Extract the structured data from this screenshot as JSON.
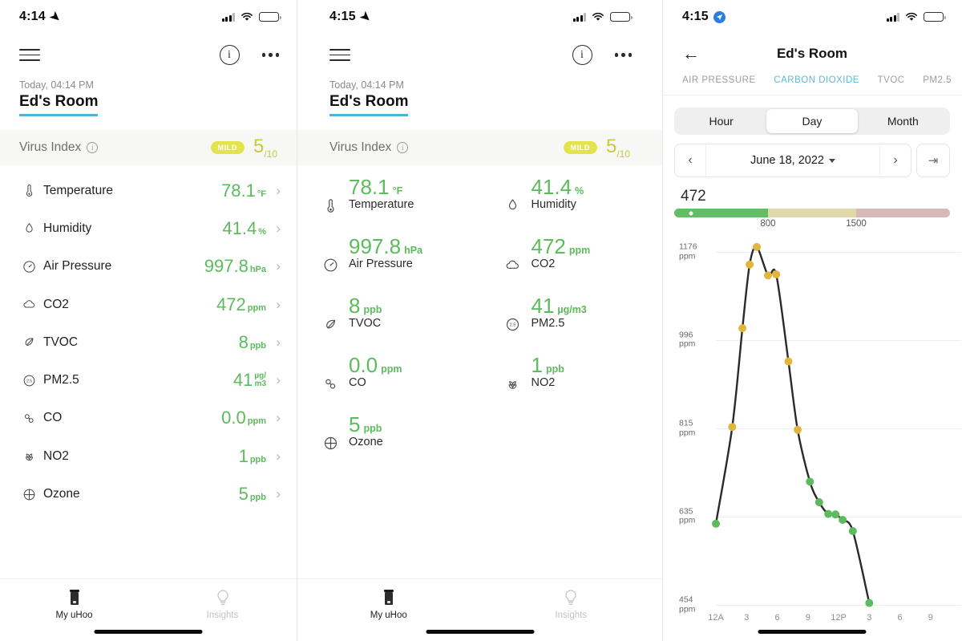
{
  "panel1": {
    "status": {
      "time": "4:14",
      "location_icon": "location-arrow-icon",
      "battery_level_pct": 42
    },
    "nav": {
      "menu_icon": "hamburger-menu-icon",
      "info_icon": "info-circle-icon",
      "more_icon": "more-options-icon"
    },
    "header": {
      "timestamp": "Today, 04:14 PM",
      "room": "Ed's Room"
    },
    "virus_index": {
      "label": "Virus Index",
      "info_icon": "info-icon",
      "badge": "MILD",
      "score": "5",
      "score_denom": "/10"
    },
    "metrics": [
      {
        "name": "Temperature",
        "icon": "thermometer-icon",
        "value": "78.1",
        "unit": "°F",
        "fill": 85
      },
      {
        "name": "Humidity",
        "icon": "droplet-icon",
        "value": "41.4",
        "unit": "%",
        "fill": 55
      },
      {
        "name": "Air Pressure",
        "icon": "gauge-icon",
        "value": "997.8",
        "unit": "hPa",
        "fill": 47
      },
      {
        "name": "CO2",
        "icon": "cloud-icon",
        "value": "472",
        "unit": "ppm",
        "fill": 14
      },
      {
        "name": "TVOC",
        "icon": "leaf-icon",
        "value": "8",
        "unit": "ppb",
        "fill": 10
      },
      {
        "name": "PM2.5",
        "icon": "particle-2-5-icon",
        "value": "41",
        "unit_top": "µg/",
        "unit_bottom": "m3",
        "fill": 80
      },
      {
        "name": "CO",
        "icon": "molecule-icon",
        "value": "0.0",
        "unit": "ppm",
        "fill": 10
      },
      {
        "name": "NO2",
        "icon": "plant-icon",
        "value": "1",
        "unit": "ppb",
        "fill": 9
      },
      {
        "name": "Ozone",
        "icon": "globe-icon",
        "value": "5",
        "unit": "ppb",
        "fill": 13
      }
    ],
    "tabbar": [
      {
        "label": "My uHoo",
        "icon": "device-icon",
        "active": true
      },
      {
        "label": "Insights",
        "icon": "lightbulb-icon",
        "active": false
      }
    ]
  },
  "panel2": {
    "status": {
      "time": "4:15",
      "battery_level_pct": 42
    },
    "header": {
      "timestamp": "Today, 04:14 PM",
      "room": "Ed's Room"
    },
    "virus_index": {
      "label": "Virus Index",
      "badge": "MILD",
      "score": "5",
      "score_denom": "/10"
    },
    "cards": [
      {
        "name": "Temperature",
        "icon": "thermometer-icon",
        "value": "78.1",
        "unit": "°F",
        "fill": 85
      },
      {
        "name": "Humidity",
        "icon": "droplet-icon",
        "value": "41.4",
        "unit": "%",
        "fill": 55
      },
      {
        "name": "Air Pressure",
        "icon": "gauge-icon",
        "value": "997.8",
        "unit": "hPa",
        "fill": 47
      },
      {
        "name": "CO2",
        "icon": "cloud-icon",
        "value": "472",
        "unit": "ppm",
        "fill": 14
      },
      {
        "name": "TVOC",
        "icon": "leaf-icon",
        "value": "8",
        "unit": "ppb",
        "fill": 10
      },
      {
        "name": "PM2.5",
        "icon": "particle-2-5-icon",
        "value": "41",
        "unit": "µg/m3",
        "fill": 80
      },
      {
        "name": "CO",
        "icon": "molecule-icon",
        "value": "0.0",
        "unit": "ppm",
        "fill": 10
      },
      {
        "name": "NO2",
        "icon": "plant-icon",
        "value": "1",
        "unit": "ppb",
        "fill": 9
      },
      {
        "name": "Ozone",
        "icon": "globe-icon",
        "value": "5",
        "unit": "ppb",
        "fill": 13
      }
    ],
    "tabbar": [
      {
        "label": "My uHoo",
        "icon": "device-icon",
        "active": true
      },
      {
        "label": "Insights",
        "icon": "lightbulb-icon",
        "active": false
      }
    ]
  },
  "panel3": {
    "status": {
      "time": "4:15",
      "location_icon": "location-badge-icon",
      "battery_level_pct": 42
    },
    "nav": {
      "back_icon": "back-arrow-icon",
      "title": "Ed's Room"
    },
    "tabs": [
      {
        "label": "AIR PRESSURE",
        "selected": false
      },
      {
        "label": "CARBON DIOXIDE",
        "selected": true
      },
      {
        "label": "TVOC",
        "selected": false
      },
      {
        "label": "PM2.5",
        "selected": false
      }
    ],
    "segments": [
      {
        "label": "Hour",
        "selected": false
      },
      {
        "label": "Day",
        "selected": true
      },
      {
        "label": "Month",
        "selected": false
      }
    ],
    "datepicker": {
      "prev_icon": "chevron-left-icon",
      "date": "June 18, 2022",
      "next_icon": "chevron-right-icon",
      "jump_today_icon": "jump-to-today-icon"
    },
    "current": {
      "value": "472"
    },
    "range": {
      "thresholds": [
        "800",
        "1500"
      ],
      "good_color": "#63bd63",
      "warn_color": "#e0d9ab",
      "bad_color": "#d6b9b9",
      "marker_pct": 6
    },
    "chart_data": {
      "type": "line",
      "title": "",
      "xlabel": "",
      "ylabel": "ppm",
      "ytick_labels": [
        "1176\nppm",
        "996\nppm",
        "815\nppm",
        "635\nppm",
        "454\nppm"
      ],
      "ytick_values": [
        1176,
        996,
        815,
        635,
        454
      ],
      "ylim": [
        454,
        1176
      ],
      "xtick_labels": [
        "12A",
        "3",
        "6",
        "9",
        "12P",
        "3",
        "6",
        "9"
      ],
      "xtick_hours": [
        0,
        3,
        6,
        9,
        12,
        15,
        18,
        21
      ],
      "xlim": [
        0,
        24
      ],
      "grid": true,
      "legend": "none",
      "line_color": "#2a2a2a",
      "point_colors": {
        "good": "#5cbb5c",
        "moderate": "#e2b53f"
      },
      "series": [
        {
          "name": "CO2",
          "unit": "ppm",
          "points": [
            {
              "hour": 0.0,
              "value": 620,
              "level": "good"
            },
            {
              "hour": 1.6,
              "value": 818,
              "level": "moderate"
            },
            {
              "hour": 2.6,
              "value": 1020,
              "level": "moderate"
            },
            {
              "hour": 3.3,
              "value": 1150,
              "level": "moderate"
            },
            {
              "hour": 4.0,
              "value": 1186,
              "level": "moderate"
            },
            {
              "hour": 5.1,
              "value": 1128,
              "level": "moderate"
            },
            {
              "hour": 5.9,
              "value": 1130,
              "level": "moderate"
            },
            {
              "hour": 7.1,
              "value": 952,
              "level": "moderate"
            },
            {
              "hour": 8.0,
              "value": 812,
              "level": "moderate"
            },
            {
              "hour": 9.2,
              "value": 706,
              "level": "good"
            },
            {
              "hour": 10.1,
              "value": 664,
              "level": "good"
            },
            {
              "hour": 11.0,
              "value": 640,
              "level": "good"
            },
            {
              "hour": 11.7,
              "value": 639,
              "level": "good"
            },
            {
              "hour": 12.4,
              "value": 628,
              "level": "good"
            },
            {
              "hour": 13.4,
              "value": 605,
              "level": "good"
            },
            {
              "hour": 15.0,
              "value": 458,
              "level": "good"
            }
          ]
        }
      ]
    }
  }
}
